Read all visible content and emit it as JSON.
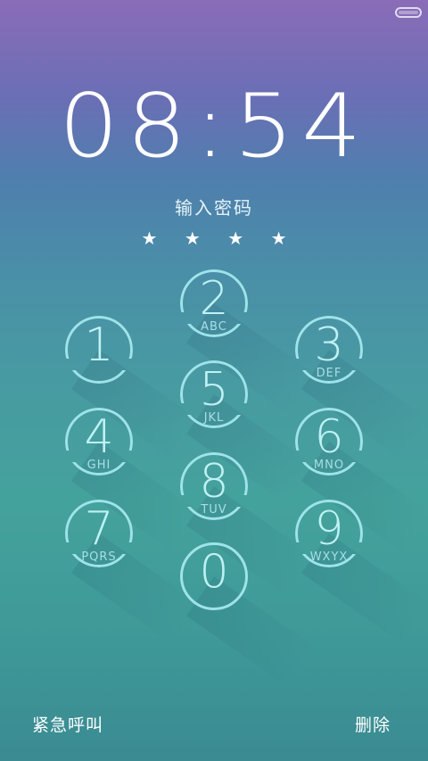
{
  "status_bar": {
    "battery_icon": "battery-icon"
  },
  "lock": {
    "time": "08:54",
    "prompt": "输入密码",
    "entered_mask": [
      "★",
      "★",
      "★",
      "★"
    ]
  },
  "keypad": [
    {
      "digit": "1",
      "letters": ""
    },
    {
      "digit": "2",
      "letters": "ABC"
    },
    {
      "digit": "3",
      "letters": "DEF"
    },
    {
      "digit": "4",
      "letters": "GHI"
    },
    {
      "digit": "5",
      "letters": "JKL"
    },
    {
      "digit": "6",
      "letters": "MNO"
    },
    {
      "digit": "7",
      "letters": "PQRS"
    },
    {
      "digit": "8",
      "letters": "TUV"
    },
    {
      "digit": "9",
      "letters": "WXYX"
    },
    {
      "digit": "0",
      "letters": ""
    }
  ],
  "actions": {
    "emergency": "紧急呼叫",
    "delete": "删除"
  },
  "colors": {
    "ring": "#9fe3ea",
    "background_top": "#8a6cb8",
    "background_bottom": "#3a8b92"
  }
}
